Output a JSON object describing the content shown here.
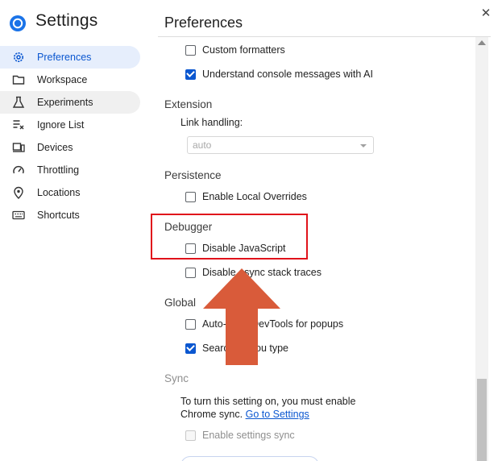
{
  "app": {
    "title": "Settings",
    "close_label": "✕"
  },
  "sidebar": {
    "items": [
      {
        "label": "Preferences",
        "icon": "gear-icon"
      },
      {
        "label": "Workspace",
        "icon": "folder-icon"
      },
      {
        "label": "Experiments",
        "icon": "flask-icon"
      },
      {
        "label": "Ignore List",
        "icon": "ignore-list-icon"
      },
      {
        "label": "Devices",
        "icon": "devices-icon"
      },
      {
        "label": "Throttling",
        "icon": "speedometer-icon"
      },
      {
        "label": "Locations",
        "icon": "location-pin-icon"
      },
      {
        "label": "Shortcuts",
        "icon": "keyboard-icon"
      }
    ]
  },
  "main": {
    "title": "Preferences",
    "options": {
      "custom_formatters": "Custom formatters",
      "understand_console": "Understand console messages with AI"
    },
    "extension": {
      "title": "Extension",
      "link_handling_label": "Link handling:",
      "link_handling_value": "auto"
    },
    "persistence": {
      "title": "Persistence",
      "enable_local_overrides": "Enable Local Overrides"
    },
    "debugger": {
      "title": "Debugger",
      "disable_javascript": "Disable JavaScript",
      "disable_async": "Disable async stack traces"
    },
    "global": {
      "title": "Global",
      "auto_open": "Auto-open DevTools for popups",
      "search_as_you_type": "Search as you type"
    },
    "sync": {
      "title": "Sync",
      "description": "To turn this setting on, you must enable",
      "description_line2": "Chrome sync.",
      "link": "Go to Settings",
      "enable_settings_sync": "Enable settings sync"
    }
  },
  "colors": {
    "accent": "#0b57d0",
    "highlight": "#e0121b",
    "arrow": "#d95b3a"
  }
}
